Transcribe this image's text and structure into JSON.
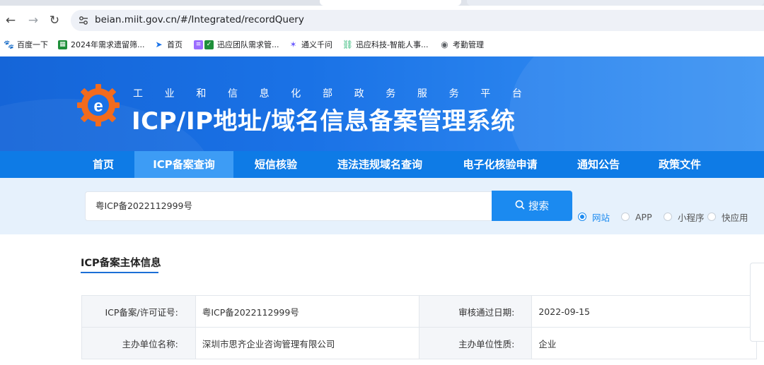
{
  "browser": {
    "url": "beian.miit.gov.cn/#/Integrated/recordQuery",
    "bookmarks": [
      {
        "label": "百度一下",
        "icon": "baidu-paw-icon",
        "color": "#2f54eb"
      },
      {
        "label": "2024年需求遗留筛...",
        "icon": "sheet-icon",
        "color": "#1f8f3a"
      },
      {
        "label": "首页",
        "icon": "cursor-icon",
        "color": "#1a73e8"
      },
      {
        "label": "迅应团队需求管...",
        "icon": "list-icon",
        "color": "#7c4dff"
      },
      {
        "label": "通义千问",
        "icon": "tongyi-icon",
        "color": "#6b5cff"
      },
      {
        "label": "迅应科技-智能人事...",
        "icon": "link-icon",
        "color": "#2bb673"
      },
      {
        "label": "考勤管理",
        "icon": "globe-icon",
        "color": "#5f6368"
      }
    ]
  },
  "header": {
    "subtitle": [
      "工",
      "业",
      "和",
      "信",
      "息",
      "化",
      "部",
      "政",
      "务",
      "服",
      "务",
      "平",
      "台"
    ],
    "title": "ICP/IP地址/域名信息备案管理系统"
  },
  "nav": {
    "items": [
      {
        "label": "首页",
        "active": false
      },
      {
        "label": "ICP备案查询",
        "active": true
      },
      {
        "label": "短信核验",
        "active": false
      },
      {
        "label": "违法违规域名查询",
        "active": false
      },
      {
        "label": "电子化核验申请",
        "active": false
      },
      {
        "label": "通知公告",
        "active": false
      },
      {
        "label": "政策文件",
        "active": false
      }
    ]
  },
  "search": {
    "value": "粤ICP备2022112999号",
    "button_label": "搜索",
    "types": [
      {
        "label": "网站",
        "selected": true
      },
      {
        "label": "APP",
        "selected": false
      },
      {
        "label": "小程序",
        "selected": false
      },
      {
        "label": "快应用",
        "selected": false
      }
    ]
  },
  "section": {
    "title": "ICP备案主体信息"
  },
  "info": {
    "rows": [
      {
        "label1": "ICP备案/许可证号:",
        "value1": "粤ICP备2022112999号",
        "label2": "审核通过日期:",
        "value2": "2022-09-15"
      },
      {
        "label1": "主办单位名称:",
        "value1": "深圳市思齐企业咨询管理有限公司",
        "label2": "主办单位性质:",
        "value2": "企业"
      }
    ]
  },
  "colors": {
    "brand": "#0e7be6",
    "accent": "#1b8af0",
    "header_bg": "#1a72e6"
  }
}
